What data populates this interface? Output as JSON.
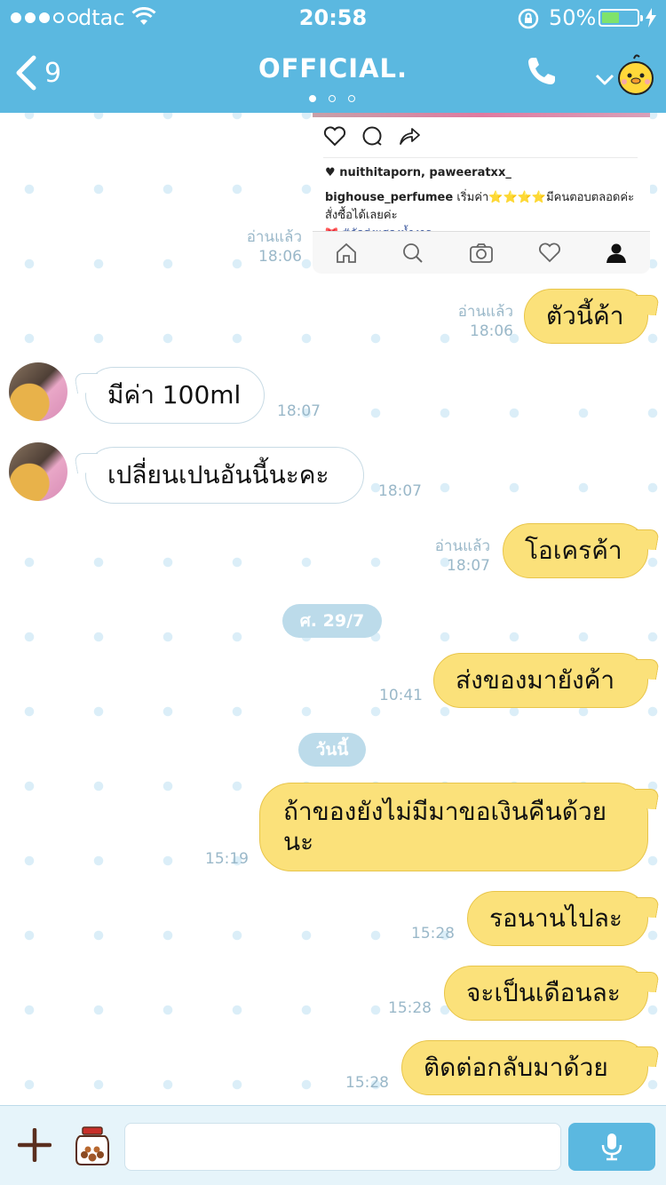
{
  "status_bar": {
    "carrier": "dtac",
    "time": "20:58",
    "battery_percent_text": "50%",
    "battery_level": 0.5,
    "signal_bars_filled": 3,
    "signal_bars_total": 5
  },
  "header": {
    "back_count": "9",
    "title": "OFFICIAL.",
    "page_dots": 3,
    "active_page_dot": 1
  },
  "instagram_post": {
    "likes": "nuithitaporn, paweeratxx_",
    "caption_user": "bighouse_perfumee",
    "caption_text": "เริ่มค่า⭐️⭐️⭐️⭐️มีคนตอบตลอดค่ะ สั่งซื้อได้เลยค่ะ",
    "hashtags": "🎀 #จัดส่งแสดงน้ำงาร"
  },
  "messages": [
    {
      "id": "m0",
      "side": "me",
      "read": "อ่านแล้ว",
      "time": "18:06"
    },
    {
      "id": "m1",
      "side": "me",
      "text": "ตัวนี้ค้า",
      "read": "อ่านแล้ว",
      "time": "18:06"
    },
    {
      "id": "m2",
      "side": "them",
      "text": "มีค่า 100ml",
      "time": "18:07"
    },
    {
      "id": "m3",
      "side": "them",
      "text": "เปลี่ยนเปนอันนี้นะคะ",
      "time": "18:07"
    },
    {
      "id": "m4",
      "side": "me",
      "text": "โอเครค้า",
      "read": "อ่านแล้ว",
      "time": "18:07"
    },
    {
      "id": "d1",
      "side": "date",
      "text": "ศ. 29/7"
    },
    {
      "id": "m5",
      "side": "me",
      "text": "ส่งของมายังค้า",
      "time": "10:41"
    },
    {
      "id": "d2",
      "side": "date",
      "text": "วันนี้"
    },
    {
      "id": "m6",
      "side": "me",
      "text": "ถ้าของยังไม่มีมาขอเงินคืนด้วย\nนะ",
      "time": "15:19"
    },
    {
      "id": "m7",
      "side": "me",
      "text": "รอนานไปละ",
      "time": "15:28"
    },
    {
      "id": "m8",
      "side": "me",
      "text": "จะเป็นเดือนละ",
      "time": "15:28"
    },
    {
      "id": "m9",
      "side": "me",
      "text": "ติดต่อกลับมาด้วย",
      "time": "15:28"
    }
  ],
  "input": {
    "placeholder": ""
  },
  "colors": {
    "header": "#5bb8e0",
    "my_bubble": "#fbe17a",
    "their_bubble": "#ffffff",
    "date_chip": "#bcdbea",
    "meta_text": "#9ab8c9"
  },
  "icons": {
    "back": "chevron-left-icon",
    "call": "phone-icon",
    "expand": "chevron-down-icon",
    "profile": "chick-mascot-icon",
    "attach": "plus-icon",
    "stickers": "sticker-jar-icon",
    "voice": "microphone-icon"
  }
}
